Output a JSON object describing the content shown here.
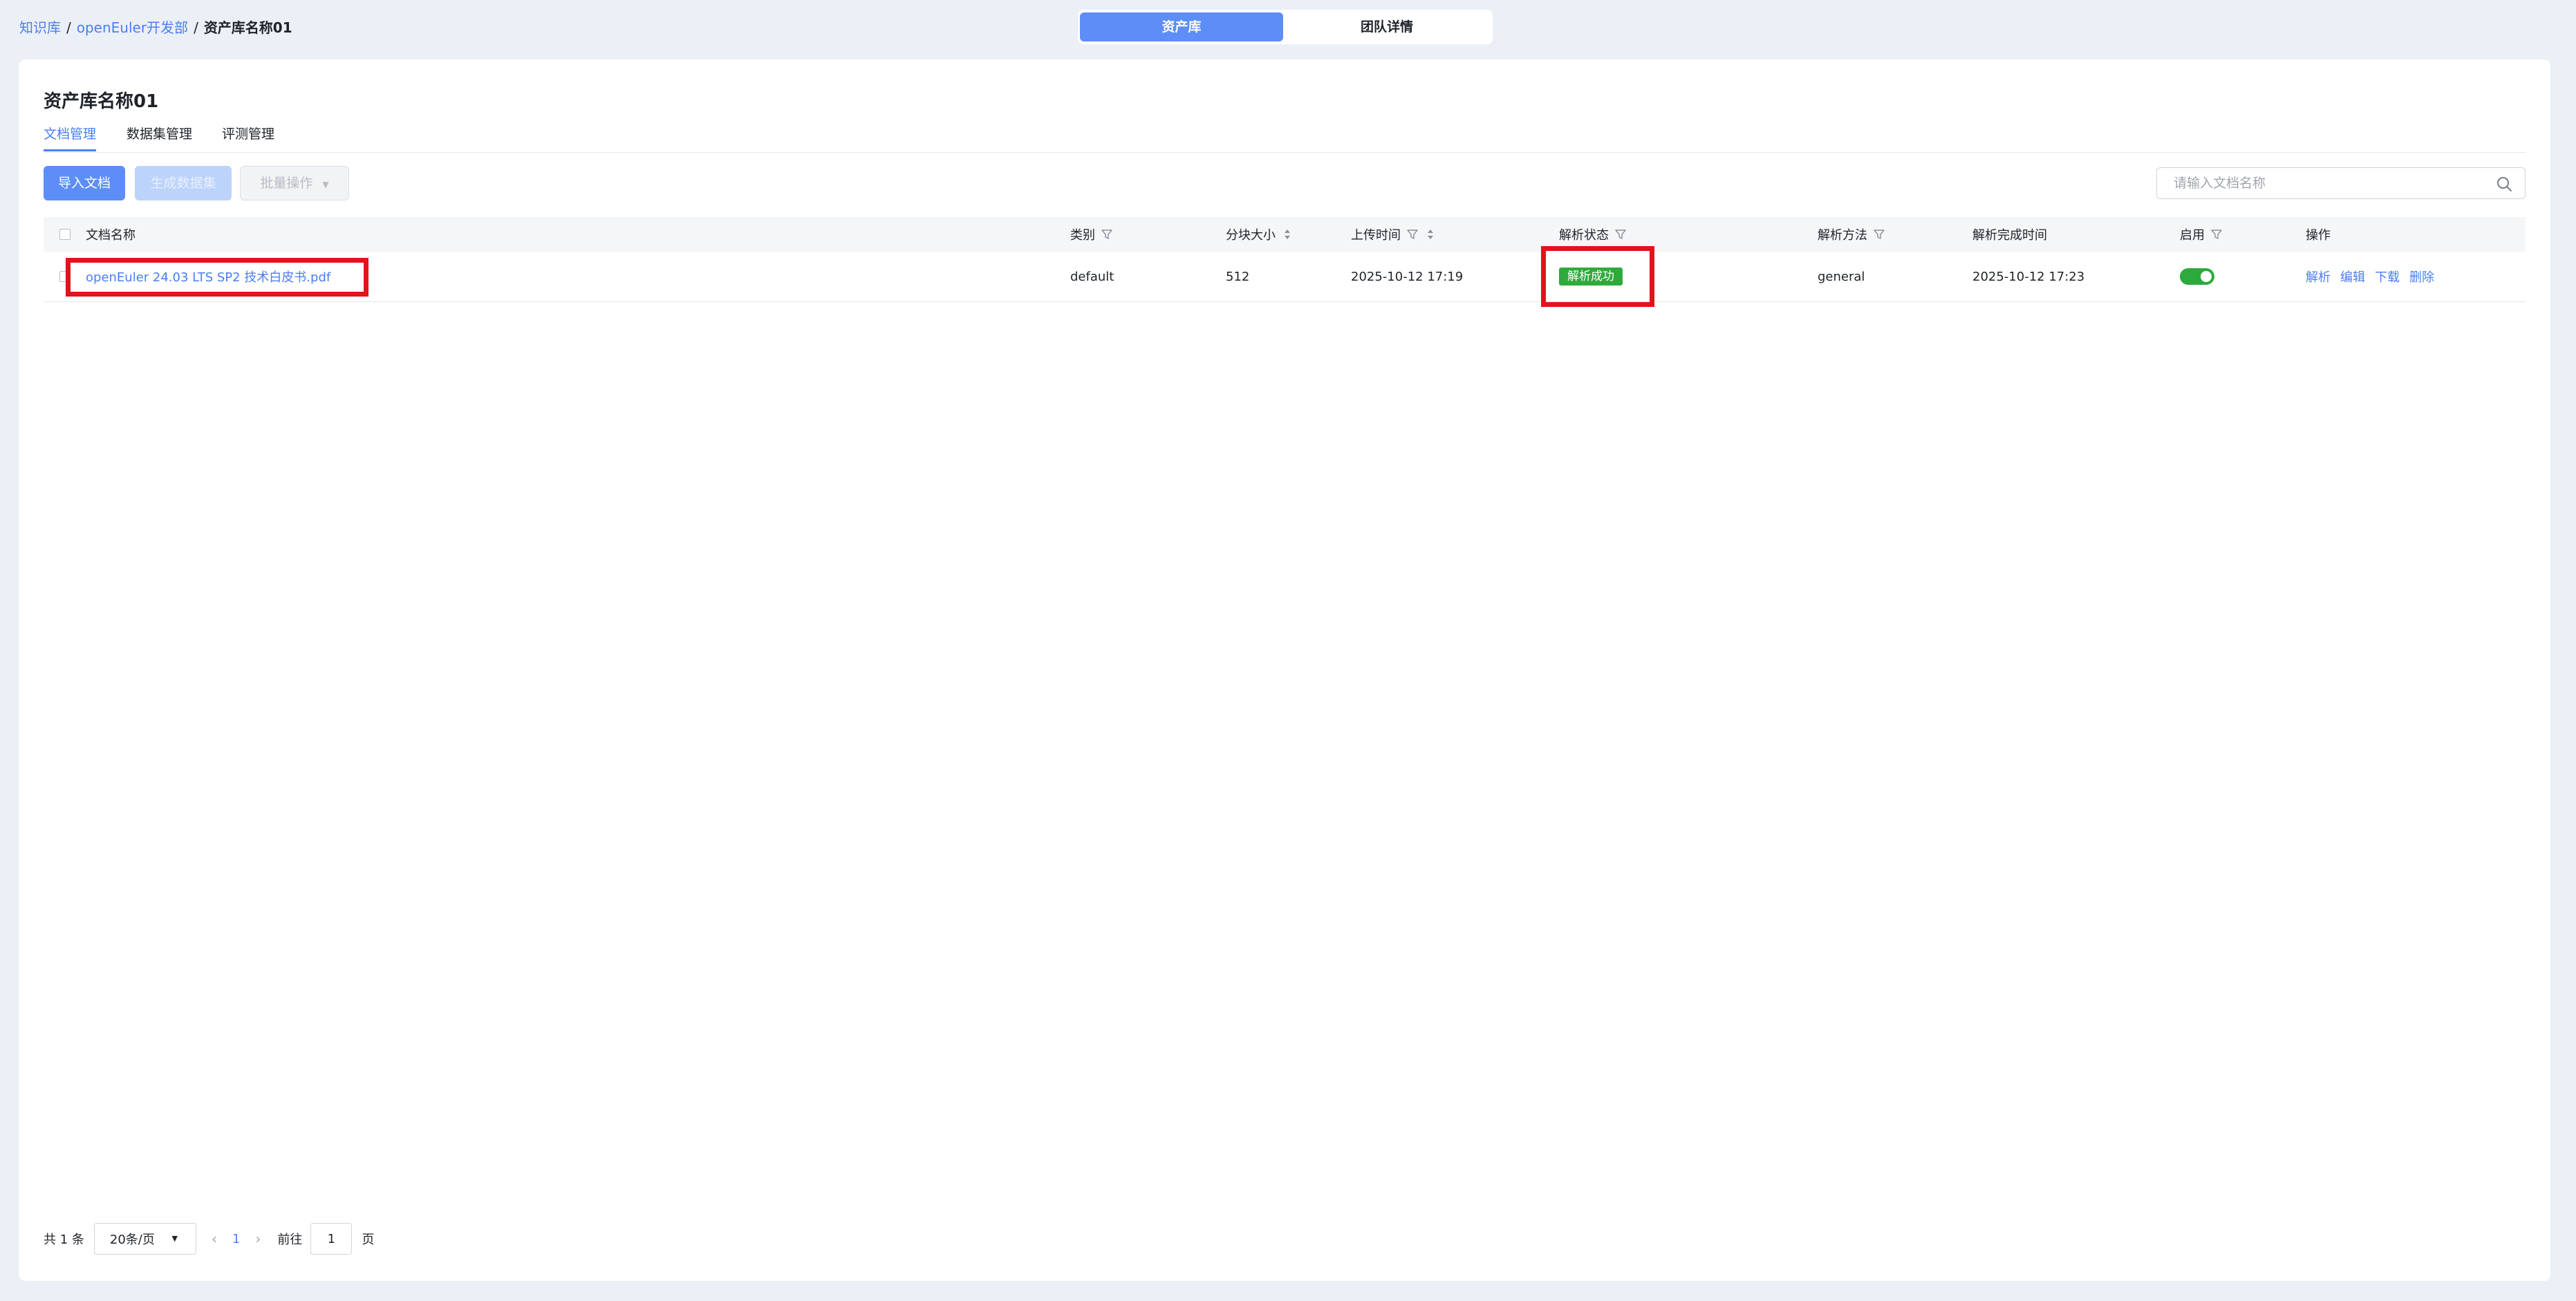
{
  "breadcrumb": {
    "root": "知识库",
    "team": "openEuler开发部",
    "current": "资产库名称01",
    "separator": "/"
  },
  "top_switch": {
    "active": "资产库",
    "inactive": "团队详情"
  },
  "page": {
    "title": "资产库名称01"
  },
  "tabs": [
    "文档管理",
    "数据集管理",
    "评测管理"
  ],
  "toolbar": {
    "import_label": "导入文档",
    "generate_label": "生成数据集",
    "batch_label": "批量操作"
  },
  "search": {
    "placeholder": "请输入文档名称"
  },
  "table": {
    "headers": {
      "name": "文档名称",
      "category": "类别",
      "chunk_size": "分块大小",
      "upload_time": "上传时间",
      "parse_status": "解析状态",
      "parse_method": "解析方法",
      "parse_done_time": "解析完成时间",
      "enabled": "启用",
      "actions": "操作"
    },
    "rows": [
      {
        "name": "openEuler 24.03 LTS SP2 技术白皮书.pdf",
        "category": "default",
        "chunk_size": "512",
        "upload_time": "2025-10-12 17:19",
        "parse_status": "解析成功",
        "parse_method": "general",
        "parse_done_time": "2025-10-12 17:23",
        "enabled": true,
        "actions": [
          "解析",
          "编辑",
          "下载",
          "删除"
        ]
      }
    ]
  },
  "pagination": {
    "total": "共 1 条",
    "page_size": "20条/页",
    "current_page": "1",
    "jump_label": "前往",
    "jump_value": "1",
    "jump_suffix": "页"
  },
  "colors": {
    "accent": "#5d8ef7",
    "link": "#4a7ef5",
    "success": "#2eaa3c",
    "highlight": "#e1141c",
    "background": "#ebeff6"
  }
}
